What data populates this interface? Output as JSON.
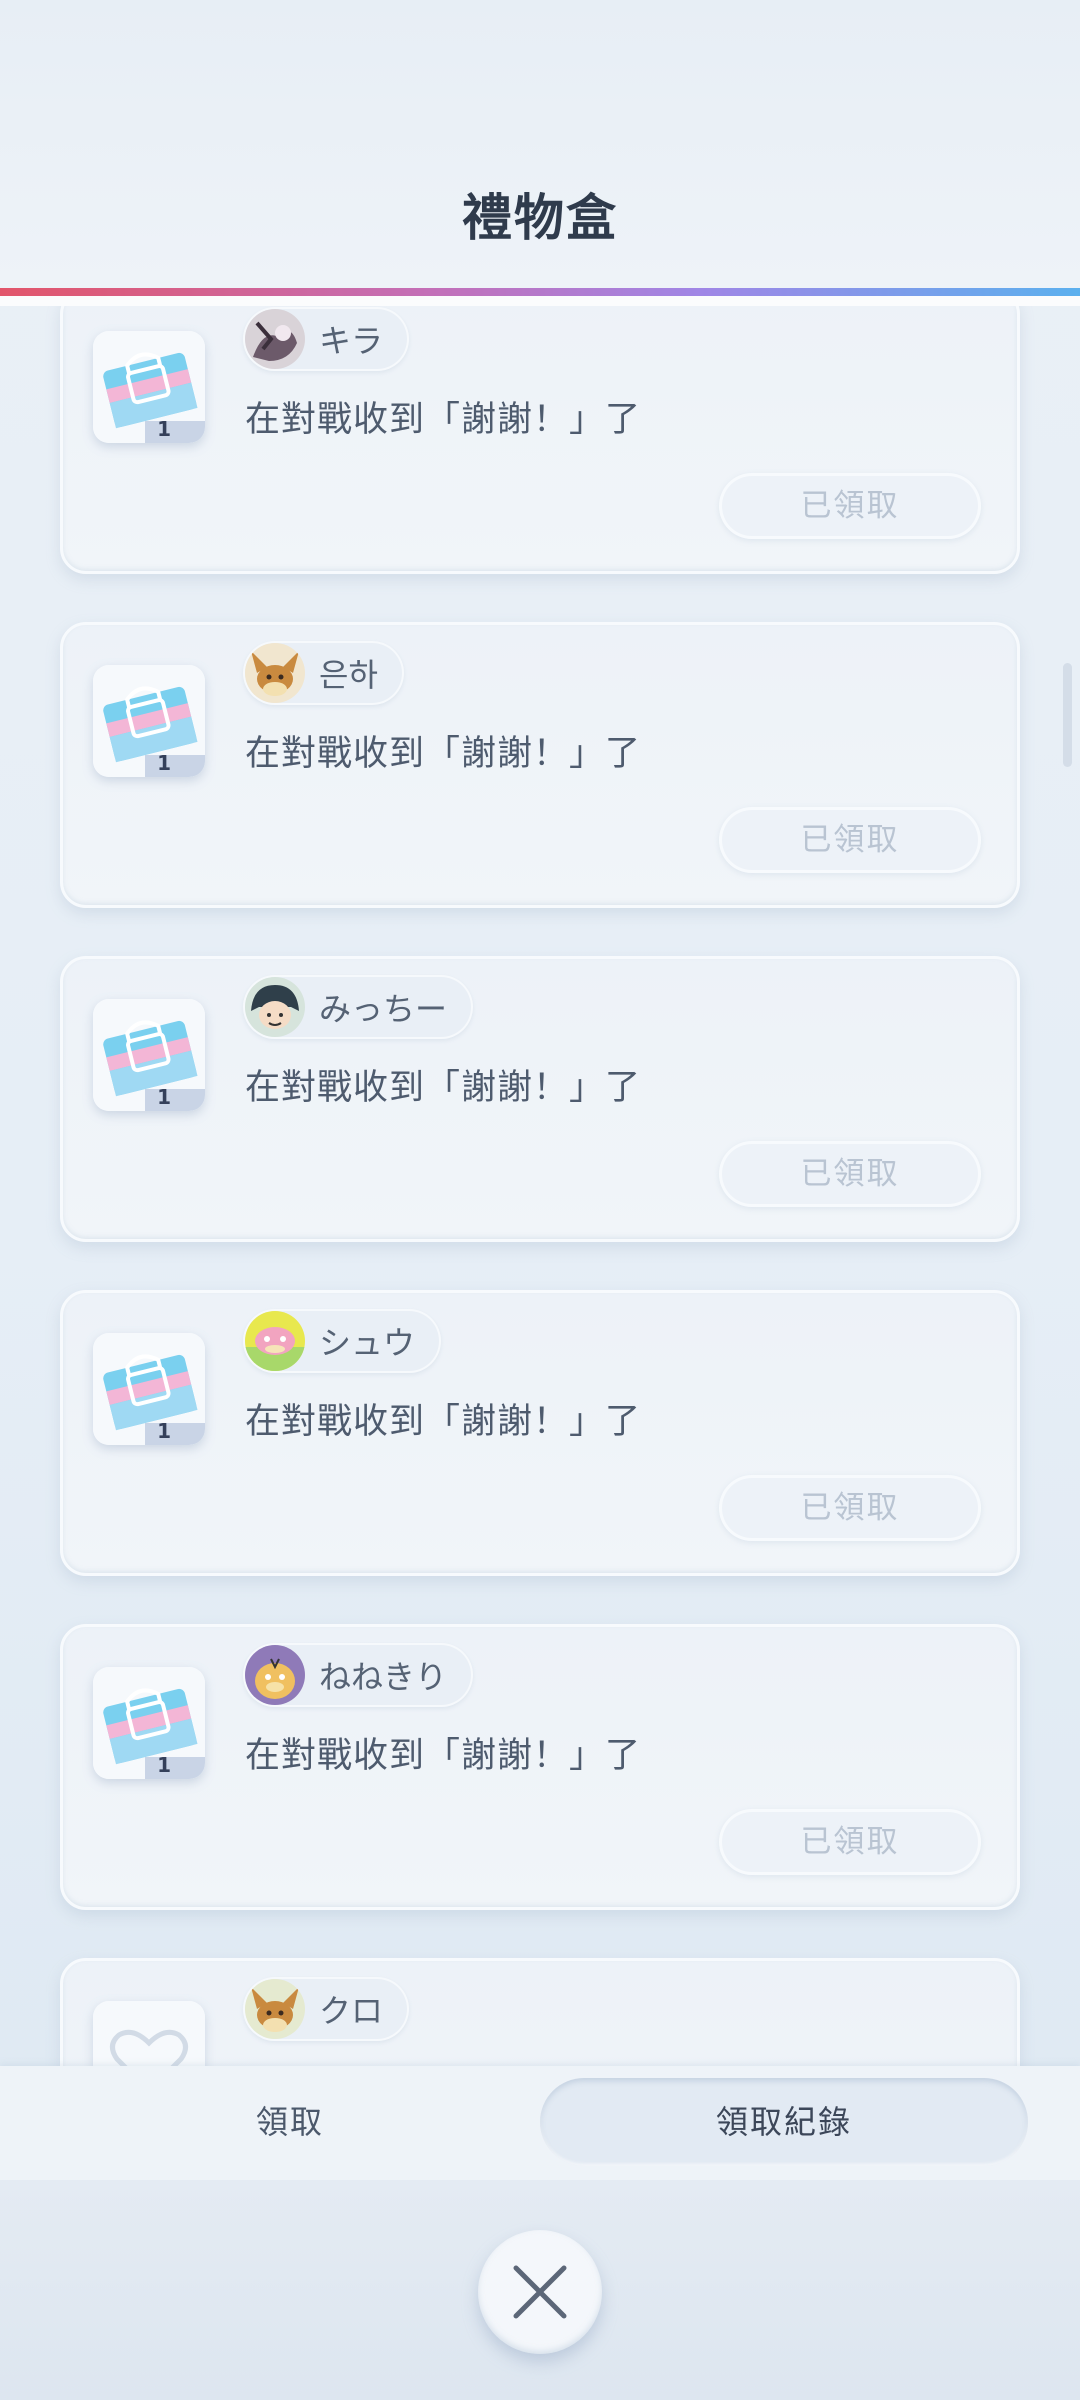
{
  "header": {
    "title": "禮物盒"
  },
  "gifts": [
    {
      "player": "キラ",
      "message": "在對戰收到「謝謝！」了",
      "quantity": "1",
      "status": "已領取",
      "avatar_icon": "kira-avatar-icon",
      "item_icon": "gift-bag-icon"
    },
    {
      "player": "은하",
      "message": "在對戰收到「謝謝！」了",
      "quantity": "1",
      "status": "已領取",
      "avatar_icon": "eevee-avatar-icon",
      "item_icon": "gift-bag-icon"
    },
    {
      "player": "みっちー",
      "message": "在對戰收到「謝謝！」了",
      "quantity": "1",
      "status": "已領取",
      "avatar_icon": "trainer-avatar-icon",
      "item_icon": "gift-bag-icon"
    },
    {
      "player": "シュウ",
      "message": "在對戰收到「謝謝！」了",
      "quantity": "1",
      "status": "已領取",
      "avatar_icon": "slowpoke-avatar-icon",
      "item_icon": "gift-bag-icon"
    },
    {
      "player": "ねねきり",
      "message": "在對戰收到「謝謝！」了",
      "quantity": "1",
      "status": "已領取",
      "avatar_icon": "psyduck-avatar-icon",
      "item_icon": "gift-bag-icon"
    },
    {
      "player": "クロ",
      "message": "",
      "quantity": "",
      "status": "",
      "avatar_icon": "eevee-avatar-icon",
      "item_icon": "heart-icon"
    }
  ],
  "tabs": {
    "claim": "領取",
    "history": "領取紀錄",
    "active": "history"
  },
  "close_icon": "close-icon",
  "colors": {
    "header_rule": [
      "#e2556a",
      "#9f86e6",
      "#5bb0ee"
    ],
    "claimed_text": "#b9c4d2",
    "title_text": "#2f3b4c"
  }
}
